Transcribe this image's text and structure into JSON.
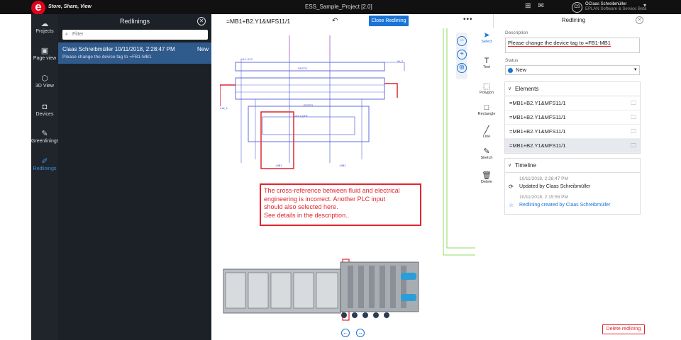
{
  "header": {
    "tagline": "Store, Share, View",
    "title": "ESS_Sample_Project [2.0]",
    "user_initials": "CS",
    "user_name": "ÖClaas Schreibmüller",
    "user_org": "EPLAN Software & Service Beta"
  },
  "sidebar": {
    "items": [
      {
        "label": "Projects",
        "icon": "cloud-icon"
      },
      {
        "label": "Page view",
        "icon": "pages-icon"
      },
      {
        "label": "3D View",
        "icon": "cube-icon"
      },
      {
        "label": "Devices",
        "icon": "device-icon"
      },
      {
        "label": "Greenlinings",
        "icon": "pen-icon"
      },
      {
        "label": "Redlinings",
        "icon": "marker-icon"
      }
    ],
    "active": "Redlinings"
  },
  "redlinings_panel": {
    "title": "Redlinings",
    "filter_placeholder": "Filter",
    "items": [
      {
        "title": "Claas Schreibmüller 10/11/2018, 2:28:47 PM",
        "badge": "New",
        "description": "Please change the device tag to =FB1-MB1"
      }
    ]
  },
  "canvas": {
    "formula": "=MB1+B2.Y1&MFS11/1",
    "close_button": "Close Redlining",
    "annotation": [
      "The cross-reference between fluid and electrical",
      "engineering is incorrect. Another PLC input",
      "should also selected here.",
      "See details in the description.."
    ]
  },
  "tools": [
    {
      "label": "Select",
      "icon": "cursor-icon"
    },
    {
      "label": "Text",
      "icon": "text-icon"
    },
    {
      "label": "Polygon",
      "icon": "polygon-icon"
    },
    {
      "label": "Rectangle",
      "icon": "rectangle-icon"
    },
    {
      "label": "Line",
      "icon": "line-icon"
    },
    {
      "label": "Sketch",
      "icon": "sketch-icon"
    },
    {
      "label": "Delete",
      "icon": "trash-icon"
    }
  ],
  "detail_panel": {
    "title": "Redlining",
    "description_label": "Description",
    "description_value": "Please change the device tag to =FB1-MB1",
    "status_label": "Status",
    "status_value": "New",
    "elements_title": "Elements",
    "elements": [
      "=MB1+B2.Y1&MFS11/1",
      "=MB1+B2.Y1&MFS11/1",
      "=MB1+B2.Y1&MFS11/1",
      "=MB1+B2.Y1&MFS11/1"
    ],
    "timeline_title": "Timeline",
    "timeline": [
      {
        "time": "10/11/2018, 2:28:47 PM",
        "text": "Updated by Claas Schreibmüller"
      },
      {
        "time": "10/11/2018, 2:15:55 PM",
        "text": "Redlining created by Claas Schreibmüller"
      }
    ],
    "delete_button": "Delete redlining"
  },
  "colors": {
    "accent": "#1a73d6",
    "redline": "#e0262e",
    "brand": "#e2001a"
  }
}
